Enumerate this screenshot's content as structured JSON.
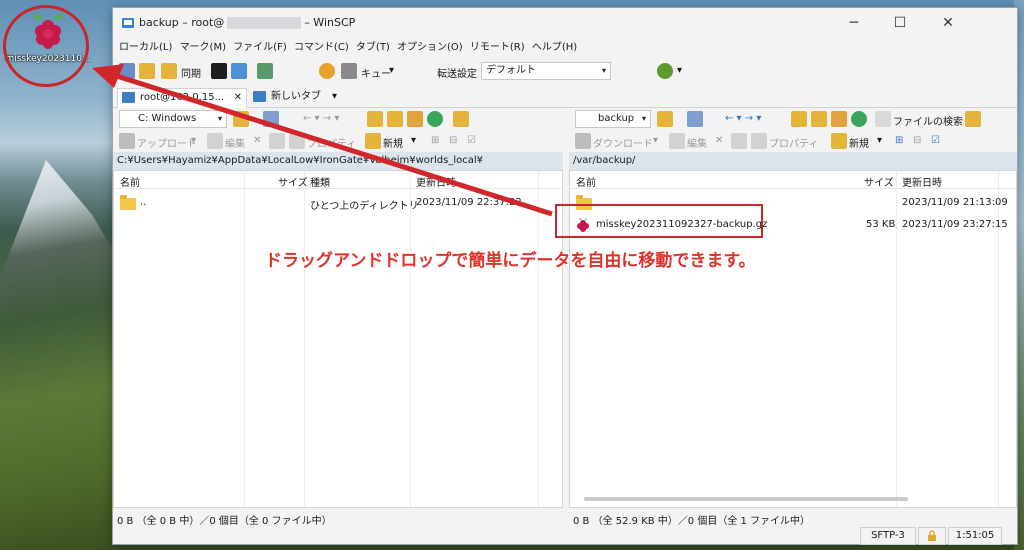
{
  "desktop": {
    "icon_label": "misskey2023110..."
  },
  "window": {
    "title_prefix": "backup – root@",
    "title_suffix": "– WinSCP",
    "min": "─",
    "max": "☐",
    "close": "✕"
  },
  "menu": [
    "ローカル(L)",
    "マーク(M)",
    "ファイル(F)",
    "コマンド(C)",
    "タブ(T)",
    "オプション(O)",
    "リモート(R)",
    "ヘルプ(H)"
  ],
  "toolbar": {
    "sync": "同期",
    "queue": "キュー",
    "transfer_label": "転送設定",
    "transfer_value": "デフォルト"
  },
  "tabs": {
    "session": "root@162.0.15...",
    "new_tab": "新しいタブ"
  },
  "local": {
    "drive": "C: Windows",
    "upload": "アップロード",
    "edit": "編集",
    "properties": "プロパティ",
    "new": "新規",
    "path": "C:¥Users¥Hayamiz¥AppData¥LocalLow¥IronGate¥Valheim¥worlds_local¥",
    "columns": {
      "name": "名前",
      "size": "サイズ",
      "type": "種類",
      "modified": "更新日時"
    },
    "rows": [
      {
        "name": "..",
        "size": "",
        "type": "ひとつ上のディレクトリ",
        "modified": "2023/11/09 22:37:22"
      }
    ],
    "status": "0 B （全 0 B 中）／0 個目（全 0 ファイル中）"
  },
  "remote": {
    "folder": "backup",
    "search": "ファイルの検索",
    "download": "ダウンロード",
    "edit": "編集",
    "properties": "プロパティ",
    "new": "新規",
    "path": "/var/backup/",
    "columns": {
      "name": "名前",
      "size": "サイズ",
      "modified": "更新日時"
    },
    "rows": [
      {
        "name": "..",
        "size": "",
        "modified": "2023/11/09 21:13:09"
      },
      {
        "name": "misskey202311092327-backup.gz",
        "size": "53 KB",
        "modified": "2023/11/09 23:27:15"
      }
    ],
    "status": "0 B （全 52.9 KB 中）／0 個目（全 1 ファイル中）"
  },
  "annotation": {
    "caption": "ドラッグアンドドロップで簡単にデータを自由に移動できます。"
  },
  "statusbar": {
    "protocol": "SFTP-3",
    "time": "1:51:05"
  },
  "colors": {
    "accent_red": "#c9252a",
    "caption_red": "#e0322b",
    "path_bg": "#dce4ec"
  }
}
